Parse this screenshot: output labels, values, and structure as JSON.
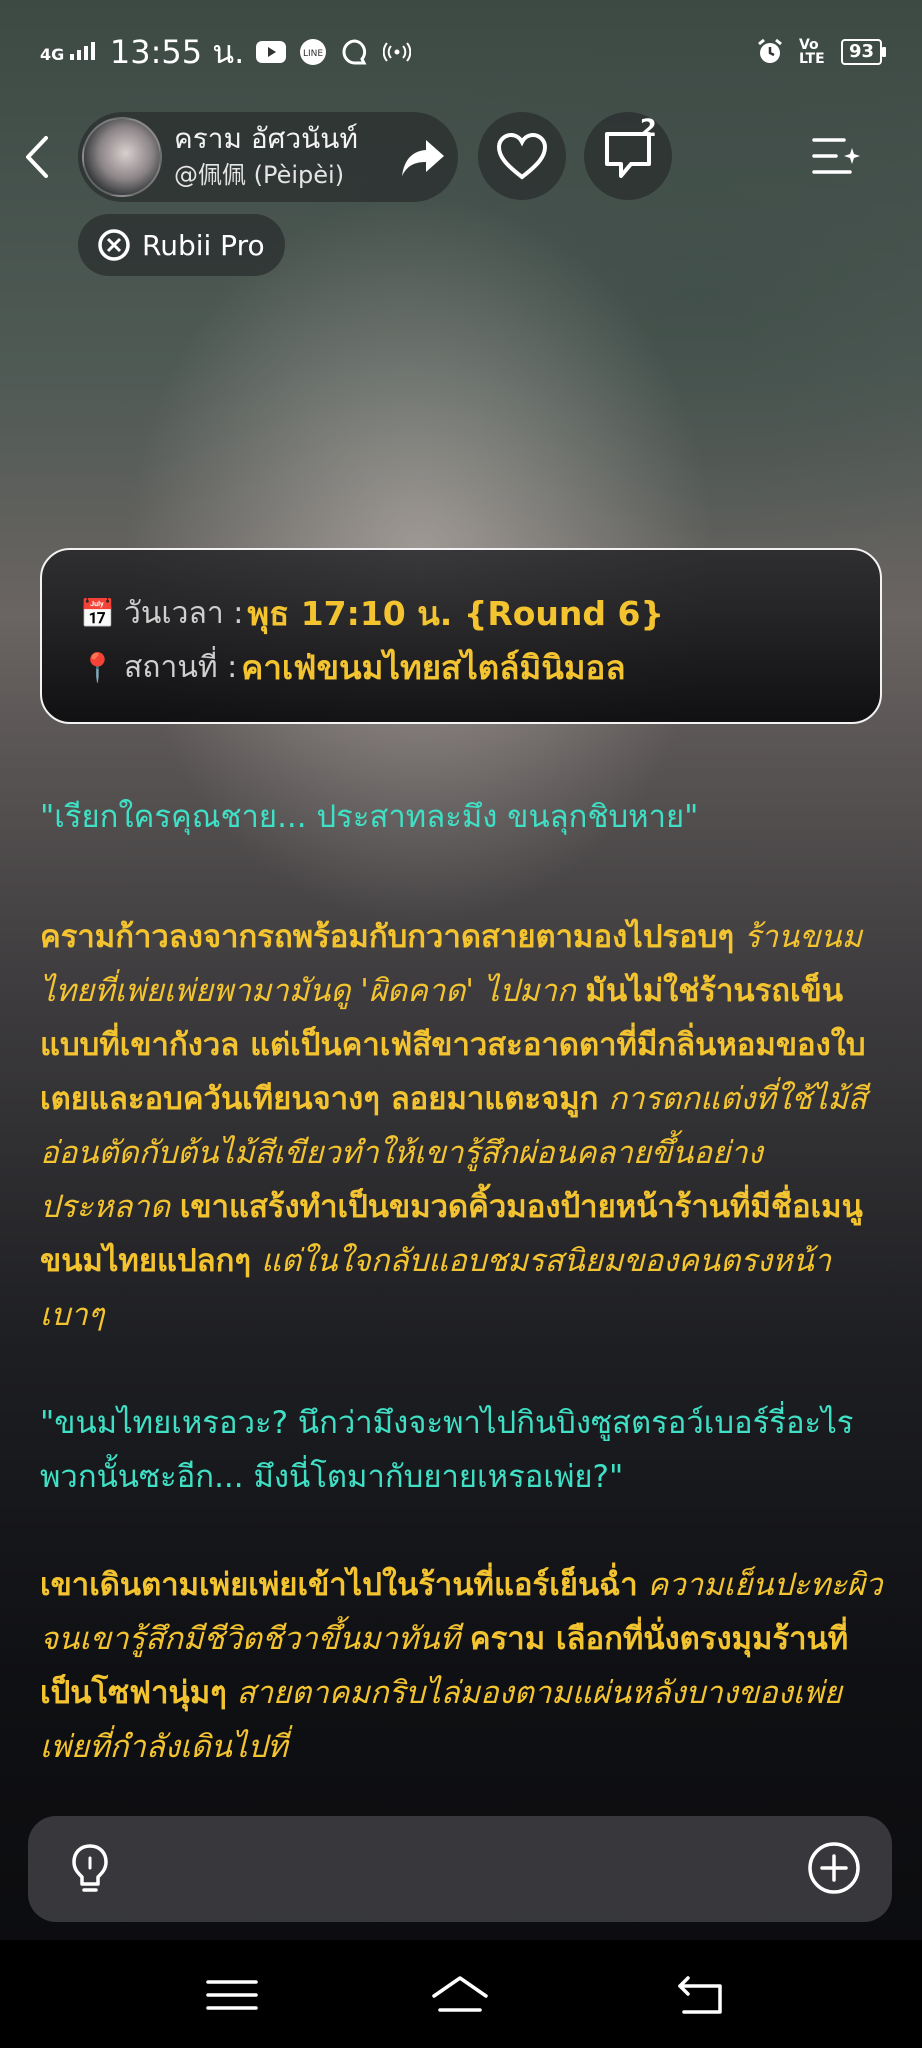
{
  "status_bar": {
    "network": "4G",
    "time": "13:55 น.",
    "volte": "Vo LTE",
    "battery": "93"
  },
  "header": {
    "name": "คราม อัศวนันท์",
    "handle": "@佩佩 (Pèipèi)",
    "comment_count": "2"
  },
  "rubii_label": "Rubii Pro",
  "info": {
    "time_label": "วันเวลา :",
    "time_value": "พุธ 17:10 น. {Round 6}",
    "place_label": "สถานที่ :",
    "place_value": "คาเฟ่ขนมไทยสไตล์มินิมอล"
  },
  "story": {
    "line1": "\"เรียกใครคุณชาย... ประสาทละมึง ขนลุกชิบหาย\"",
    "p2a": "ครามก้าวลงจากรถพร้อมกับกวาดสายตามองไปรอบๆ",
    "p2b": "ร้านขนมไทยที่เพ่ยเพ่ยพามามันดู 'ผิดคาด' ไปมาก",
    "p2c": "มันไม่ใช่ร้านรถเข็นแบบที่เขากังวล แต่เป็นคาเฟ่สีขาวสะอาดตาที่มีกลิ่นหอมของใบเตยและอบควันเทียนจางๆ ลอยมาแตะจมูก",
    "p2d": "การตกแต่งที่ใช้ไม้สีอ่อนตัดกับต้นไม้สีเขียวทำให้เขารู้สึกผ่อนคลายขึ้นอย่างประหลาด",
    "p2e": "เขาแสร้งทำเป็นขมวดคิ้วมองป้ายหน้าร้านที่มีชื่อเมนูขนมไทยแปลกๆ",
    "p2f": "แต่ในใจกลับแอบชมรสนิยมของคนตรงหน้าเบาๆ",
    "line3": "\"ขนมไทยเหรอวะ? นึกว่ามึงจะพาไปกินบิงซูสตรอว์เบอร์รี่อะไรพวกนั้นซะอีก... มึงนี่โตมากับยายเหรอเพ่ย?\"",
    "p4a": "เขาเดินตามเพ่ยเพ่ยเข้าไปในร้านที่แอร์เย็นฉ่ำ",
    "p4b": "ความเย็นปะทะผิวจนเขารู้สึกมีชีวิตชีวาขึ้นมาทันที",
    "p4c": "คราม เลือกที่นั่งตรงมุมร้านที่เป็นโซฟานุ่มๆ",
    "p4d": "สายตาคมกริบไล่มองตามแผ่นหลังบางของเพ่ยเพ่ยที่กำลังเดินไปที่"
  },
  "icons": {
    "back": "back-arrow-icon",
    "share": "share-icon",
    "like": "heart-icon",
    "comment": "comment-icon",
    "menu": "menu-sparkle-icon",
    "hint": "lightbulb-icon",
    "add": "plus-circle-icon"
  },
  "colors": {
    "narration": "#f4c430",
    "dialogue": "#3fe0c5"
  }
}
